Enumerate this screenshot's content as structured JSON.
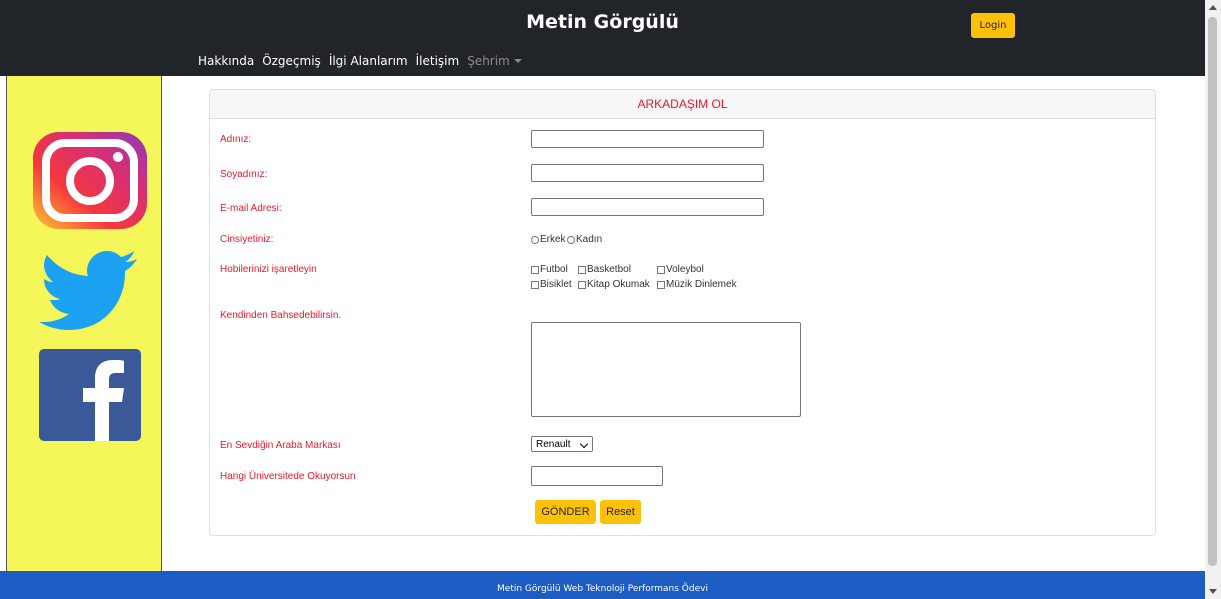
{
  "header": {
    "title": "Metin Görgülü",
    "login_label": "Login",
    "nav": [
      {
        "label": "Hakkında"
      },
      {
        "label": "Özgeçmiş"
      },
      {
        "label": "İlgi Alanlarım"
      },
      {
        "label": "İletişim"
      },
      {
        "label": "Şehrim"
      }
    ]
  },
  "sidebar": {
    "icons": [
      "instagram-icon",
      "twitter-icon",
      "facebook-icon"
    ]
  },
  "form": {
    "title": "ARKADAŞIM OL",
    "first_name_label": "Adınız:",
    "first_name_value": "",
    "last_name_label": "Soyadınız:",
    "last_name_value": "",
    "email_label": "E-mail Adresi:",
    "email_value": "",
    "gender_label": "Cinsiyetiniz:",
    "gender_options": [
      "Erkek",
      "Kadın"
    ],
    "hobbies_label": "Hobilerinizi işaretleyin",
    "hobbies": [
      "Futbol",
      "Basketbol",
      "Voleybol",
      "Bisiklet",
      "Kitap Okumak",
      "Müzik Dinlemek"
    ],
    "about_label": "Kendinden Bahsedebilirsin.",
    "about_value": "",
    "car_label": "En Sevdiğin Araba Markası",
    "car_selected": "Renault",
    "university_label": "Hangi Üniversitede Okuyorsun",
    "university_value": "",
    "submit_label": "GÖNDER",
    "reset_label": "Reset"
  },
  "footer": {
    "text": "Metin Görgülü Web Teknoloji Performans Ödevi"
  },
  "colors": {
    "header_bg": "#212529",
    "accent_yellow": "#ffc107",
    "sidebar_bg": "#f4f65a",
    "label_red": "#e8192c",
    "footer_blue": "#1c5cc3"
  }
}
